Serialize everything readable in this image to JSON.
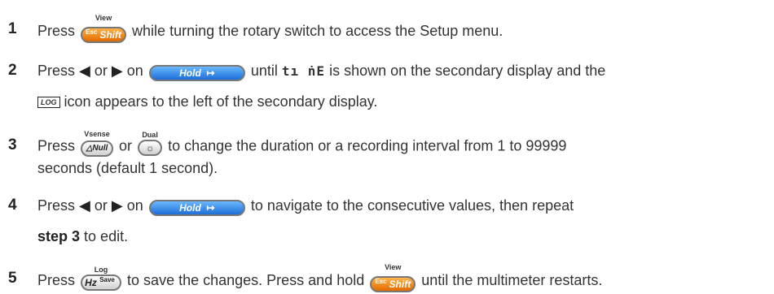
{
  "steps": [
    {
      "num": "1",
      "l1a": "Press",
      "l1b": "while turning the rotary switch to access the Setup menu."
    },
    {
      "num": "2",
      "l1a": "Press",
      "l1b": "or",
      "l1c": "on",
      "l1d": "until",
      "seg": "tı ṅE",
      "l1e": "is shown on the secondary display and the",
      "l2a": "icon appears to the left of the secondary display."
    },
    {
      "num": "3",
      "l1a": "Press",
      "l1b": "or",
      "l1c": "to change the duration or a recording interval from 1 to 99999",
      "l2a": "seconds (default 1 second)."
    },
    {
      "num": "4",
      "l1a": "Press",
      "l1b": "or",
      "l1c": "on",
      "l1d": "to navigate to the consecutive values, then repeat",
      "l2bold": "step 3",
      "l2a": "to edit."
    },
    {
      "num": "5",
      "l1a": "Press",
      "l1b": "to save the changes. Press and hold",
      "l1c": "until the multimeter restarts."
    }
  ],
  "keys": {
    "shift": {
      "caption": "View",
      "sub": "Esc",
      "label": "Shift"
    },
    "hold": {
      "label": "Hold",
      "arrow": "↦"
    },
    "null": {
      "caption": "Vsense",
      "label": "△Null"
    },
    "dual": {
      "caption": "Dual",
      "label": "☼"
    },
    "hz": {
      "caption": "Log",
      "label": "Hz",
      "sub": "Save"
    }
  },
  "icons": {
    "left": "◀",
    "right": "▶",
    "log": "LOG"
  }
}
